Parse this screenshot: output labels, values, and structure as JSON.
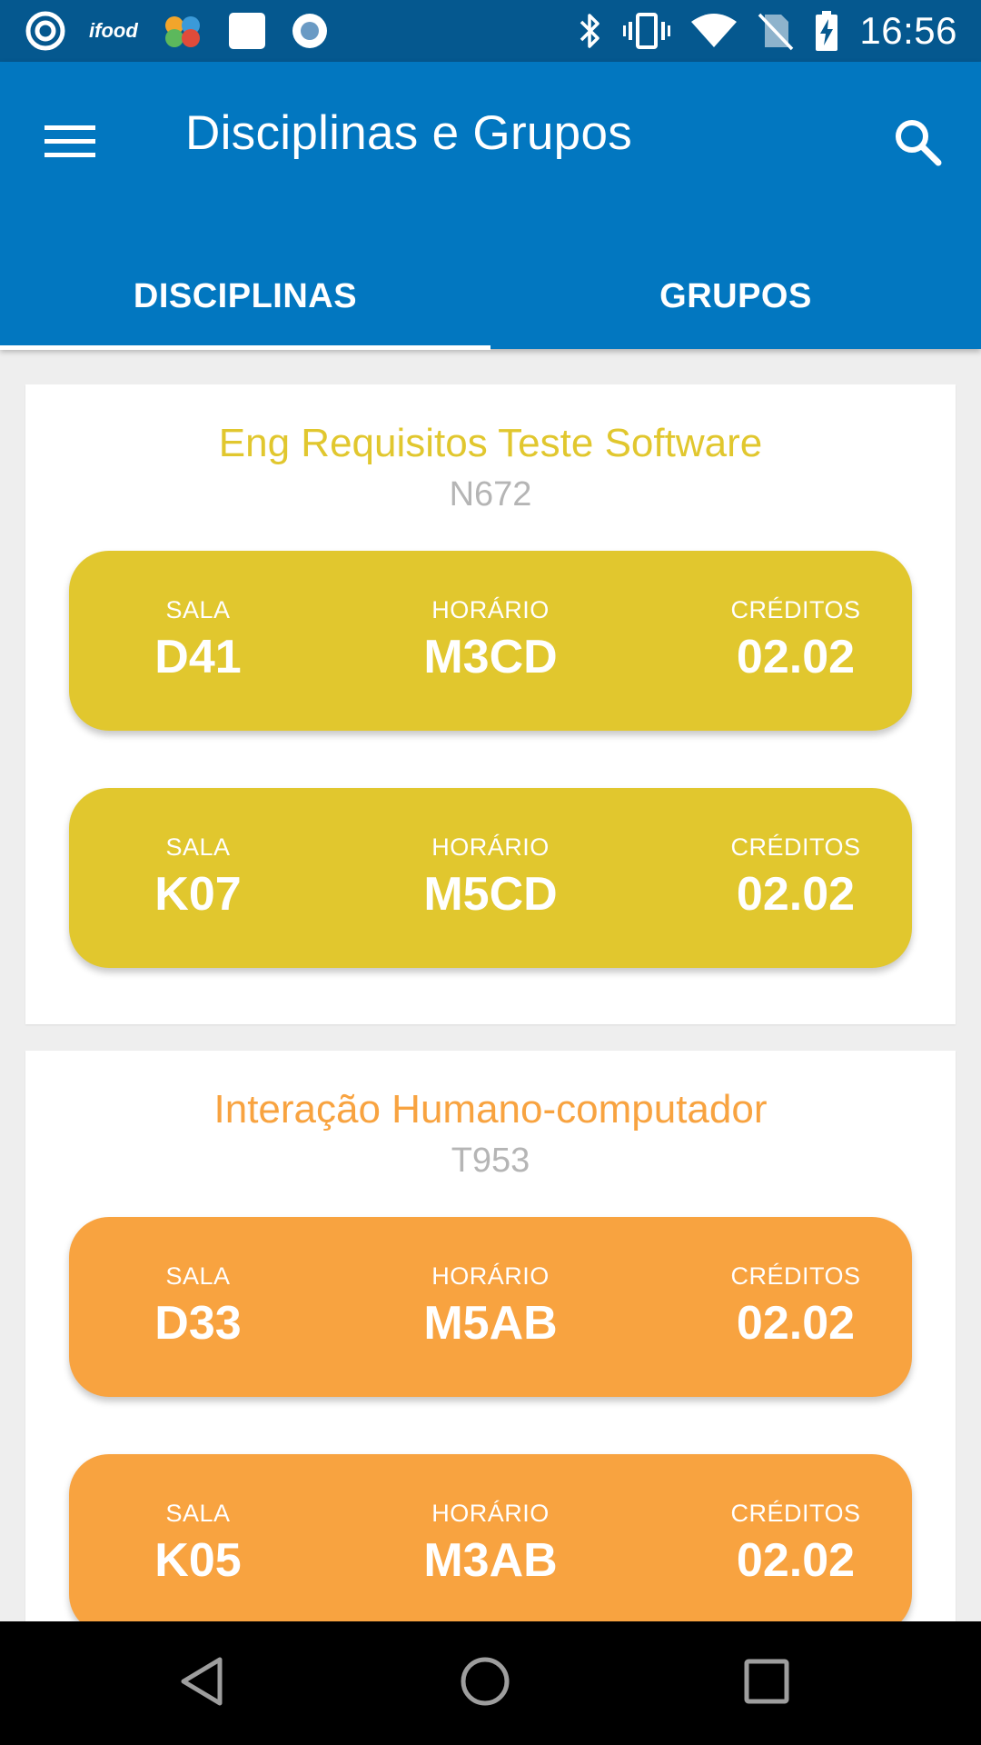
{
  "status_bar": {
    "time": "16:56",
    "app_icons": [
      "pinterest-like-icon",
      "ifood-icon",
      "puzzle-app-icon",
      "square-app-icon",
      "circle-app-icon"
    ],
    "ifood_label": "ifood",
    "system_icons": [
      "bluetooth-icon",
      "vibrate-icon",
      "wifi-icon",
      "no-sim-icon",
      "battery-charging-icon"
    ]
  },
  "app_bar": {
    "title": "Disciplinas e Grupos",
    "tabs": [
      {
        "label": "DISCIPLINAS",
        "active": true
      },
      {
        "label": "GRUPOS",
        "active": false
      }
    ]
  },
  "colors": {
    "status_bar": "#05588f",
    "app_bar": "#0277c0",
    "yellow": "#e1c72e",
    "orange": "#f8a340",
    "code_gray": "#b5b5b5"
  },
  "courses": [
    {
      "name": "Eng Requisitos Teste Software",
      "code": "N672",
      "color": "#e1c72e",
      "classes": [
        {
          "sala_label": "SALA",
          "sala": "D41",
          "horario_label": "HORÁRIO",
          "horario": "M3CD",
          "creditos_label": "CRÉDITOS",
          "creditos": "02.02"
        },
        {
          "sala_label": "SALA",
          "sala": "K07",
          "horario_label": "HORÁRIO",
          "horario": "M5CD",
          "creditos_label": "CRÉDITOS",
          "creditos": "02.02"
        }
      ]
    },
    {
      "name": "Interação Humano-computador",
      "code": "T953",
      "color": "#f8a340",
      "classes": [
        {
          "sala_label": "SALA",
          "sala": "D33",
          "horario_label": "HORÁRIO",
          "horario": "M5AB",
          "creditos_label": "CRÉDITOS",
          "creditos": "02.02"
        },
        {
          "sala_label": "SALA",
          "sala": "K05",
          "horario_label": "HORÁRIO",
          "horario": "M3AB",
          "creditos_label": "CRÉDITOS",
          "creditos": "02.02"
        }
      ]
    }
  ],
  "nav_bar": {
    "buttons": [
      "back-icon",
      "home-icon",
      "recents-icon"
    ]
  }
}
